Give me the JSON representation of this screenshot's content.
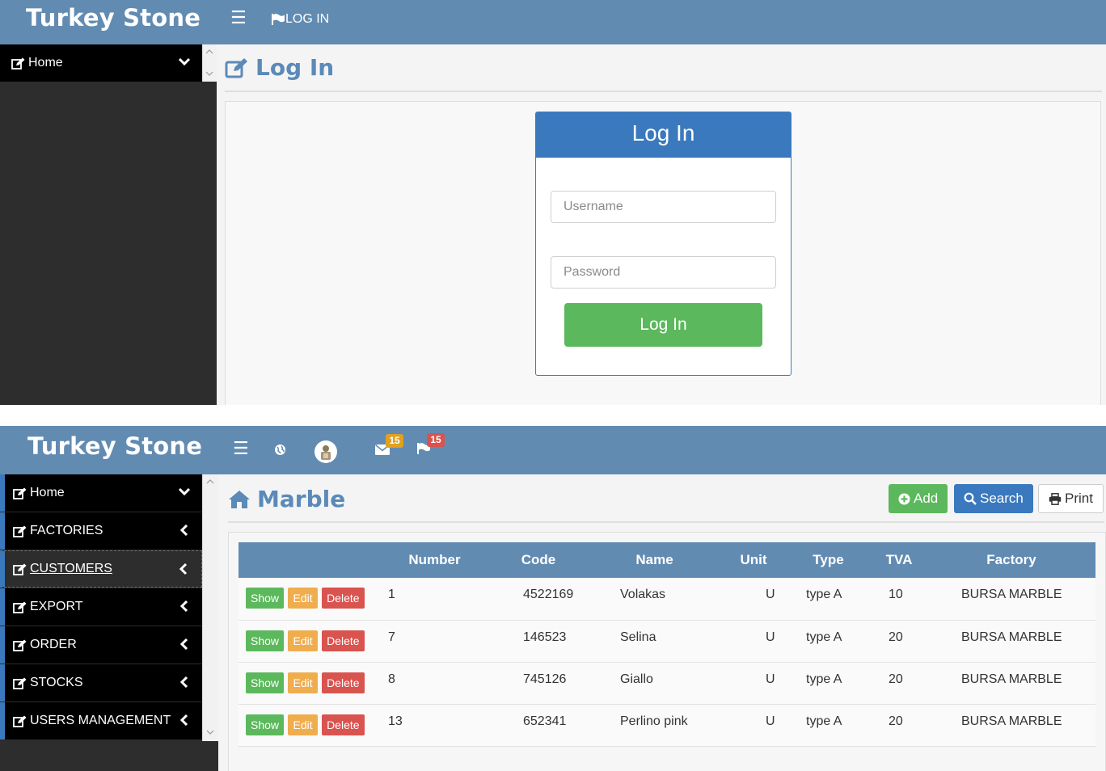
{
  "login_panel": {
    "brand": "Turkey Stone",
    "nav_login_label": "LOG IN",
    "sidebar": {
      "home_label": "Home"
    },
    "page_title": "Log In",
    "form": {
      "heading": "Log In",
      "username_placeholder": "Username",
      "password_placeholder": "Password",
      "submit_label": "Log In"
    }
  },
  "list_panel": {
    "brand": "Turkey Stone",
    "topbar": {
      "mail_badge": "15",
      "flag_badge": "15",
      "mail_badge_color": "#e0a020",
      "flag_badge_color": "#d9534f"
    },
    "sidebar": {
      "items": [
        {
          "label": "Home",
          "icon": "chevron-down-icon"
        },
        {
          "label": "FACTORIES",
          "icon": "chevron-left-icon"
        },
        {
          "label": "CUSTOMERS",
          "icon": "chevron-left-icon"
        },
        {
          "label": "EXPORT",
          "icon": "chevron-left-icon"
        },
        {
          "label": "ORDER",
          "icon": "chevron-left-icon"
        },
        {
          "label": "STOCKS",
          "icon": "chevron-left-icon"
        },
        {
          "label": "USERS MANAGEMENT",
          "icon": "chevron-left-icon"
        }
      ]
    },
    "page_title": "Marble",
    "actions": {
      "add_label": "Add",
      "search_label": "Search",
      "print_label": "Print"
    },
    "table": {
      "columns": [
        "",
        "Number",
        "Code",
        "Name",
        "Unit",
        "Type",
        "TVA",
        "Factory"
      ],
      "row_actions": {
        "show": "Show",
        "edit": "Edit",
        "delete": "Delete"
      },
      "rows": [
        {
          "number": "1",
          "code": "4522169",
          "name": "Volakas",
          "unit": "U",
          "type": "type A",
          "tva": "10",
          "factory": "BURSA MARBLE"
        },
        {
          "number": "7",
          "code": "146523",
          "name": "Selina",
          "unit": "U",
          "type": "type A",
          "tva": "20",
          "factory": "BURSA MARBLE"
        },
        {
          "number": "8",
          "code": "745126",
          "name": "Giallo",
          "unit": "U",
          "type": "type A",
          "tva": "20",
          "factory": "BURSA MARBLE"
        },
        {
          "number": "13",
          "code": "652341",
          "name": "Perlino pink",
          "unit": "U",
          "type": "type A",
          "tva": "20",
          "factory": "BURSA MARBLE"
        }
      ]
    }
  },
  "colors": {
    "topbar": "#628bb2",
    "title": "#5b8ab8",
    "primary": "#3a79bd",
    "success": "#5cb85c",
    "warning": "#f0ad4e",
    "danger": "#d9534f"
  }
}
